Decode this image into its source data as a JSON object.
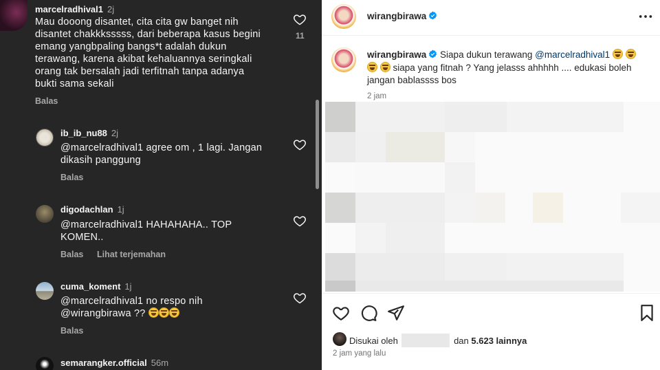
{
  "comments_panel": {
    "comments": [
      {
        "username": "marcelradhival1",
        "time": "2j",
        "lines": [
          "Mau dooong disantet, cita cita gw banget nih",
          "disantet chakkksssss, dari beberapa kasus begini",
          "emang yangbpaling bangs*t adalah dukun",
          "terawang, karena akibat kehaluannya seringkali",
          "orang tak bersalah jadi terfitnah tanpa adanya",
          "bukti sama sekali"
        ],
        "likes": "11",
        "reply_label": "Balas"
      },
      {
        "username": "ib_ib_nu88",
        "time": "2j",
        "lines": [
          "@marcelradhival1 agree om , 1 lagi. Jangan",
          "dikasih panggung"
        ],
        "reply_label": "Balas"
      },
      {
        "username": "digodachlan",
        "time": "1j",
        "lines": [
          "@marcelradhival1 HAHAHAHA.. TOP",
          "KOMEN.."
        ],
        "reply_label": "Balas",
        "translate_label": "Lihat terjemahan"
      },
      {
        "username": "cuma_koment",
        "time": "1j",
        "lines": [
          "@marcelradhival1 no respo nih",
          "@wirangbirawa ??"
        ],
        "reply_label": "Balas"
      },
      {
        "username": "semarangker.official",
        "time": "56m"
      }
    ]
  },
  "post_panel": {
    "header": {
      "username": "wirangbirawa",
      "more_icon": "more-horizontal-icon"
    },
    "caption": {
      "username": "wirangbirawa",
      "text_part1": "Siapa dukun terawang",
      "mention": "@marcelradhival1",
      "text_line2": "siapa yang fitnah ? Yang jelasss ahhhhh .... edukasi boleh",
      "text_line3": "jangan bablassss bos",
      "time": "2 jam"
    },
    "actions": {
      "like_icon": "heart-icon",
      "comment_icon": "comment-icon",
      "share_icon": "share-icon",
      "save_icon": "bookmark-icon"
    },
    "likes": {
      "prefix": "Disukai oleh",
      "connector": "dan",
      "count": "5.623 lainnya"
    },
    "post_time": "2 jam yang lalu"
  },
  "colors": {
    "dark_bg": "#262626",
    "verified": "#0095f6",
    "mention": "#00376b"
  }
}
